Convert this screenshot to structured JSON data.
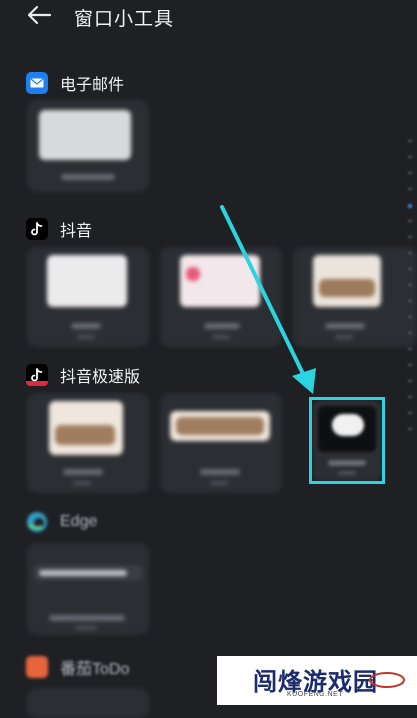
{
  "header": {
    "title": "窗口小工具",
    "back_icon": "back-arrow-icon"
  },
  "sections": [
    {
      "label": "电子邮件",
      "icon": "mail-app-icon",
      "icon_color": "#1e7ff0",
      "widgets": [
        {
          "caption": "电子邮件"
        }
      ]
    },
    {
      "label": "抖音",
      "icon": "douyin-app-icon",
      "icon_color": "#000000",
      "widgets": [
        {
          "caption": "抖音"
        },
        {
          "caption": "抖音订单"
        },
        {
          "caption": "抖音热点"
        }
      ]
    },
    {
      "label": "抖音极速版",
      "icon": "douyin-lite-app-icon",
      "icon_color": "#000000",
      "widgets": [
        {
          "caption": "抖音热点"
        },
        {
          "caption": "抖音热点"
        },
        {
          "caption": "抖音聊天"
        }
      ]
    },
    {
      "label": "Edge",
      "icon": "edge-app-icon",
      "icon_color": "#2fa0c4",
      "widgets": [
        {
          "caption": "Edge search"
        }
      ]
    },
    {
      "label": "番茄ToDo",
      "icon": "tomato-todo-app-icon",
      "icon_color": "#e8643c"
    }
  ],
  "annotation": {
    "arrow_color": "#2bd4de"
  },
  "watermark": {
    "text": "闯烽游戏园",
    "subtext": "KUOFENG.NET"
  }
}
